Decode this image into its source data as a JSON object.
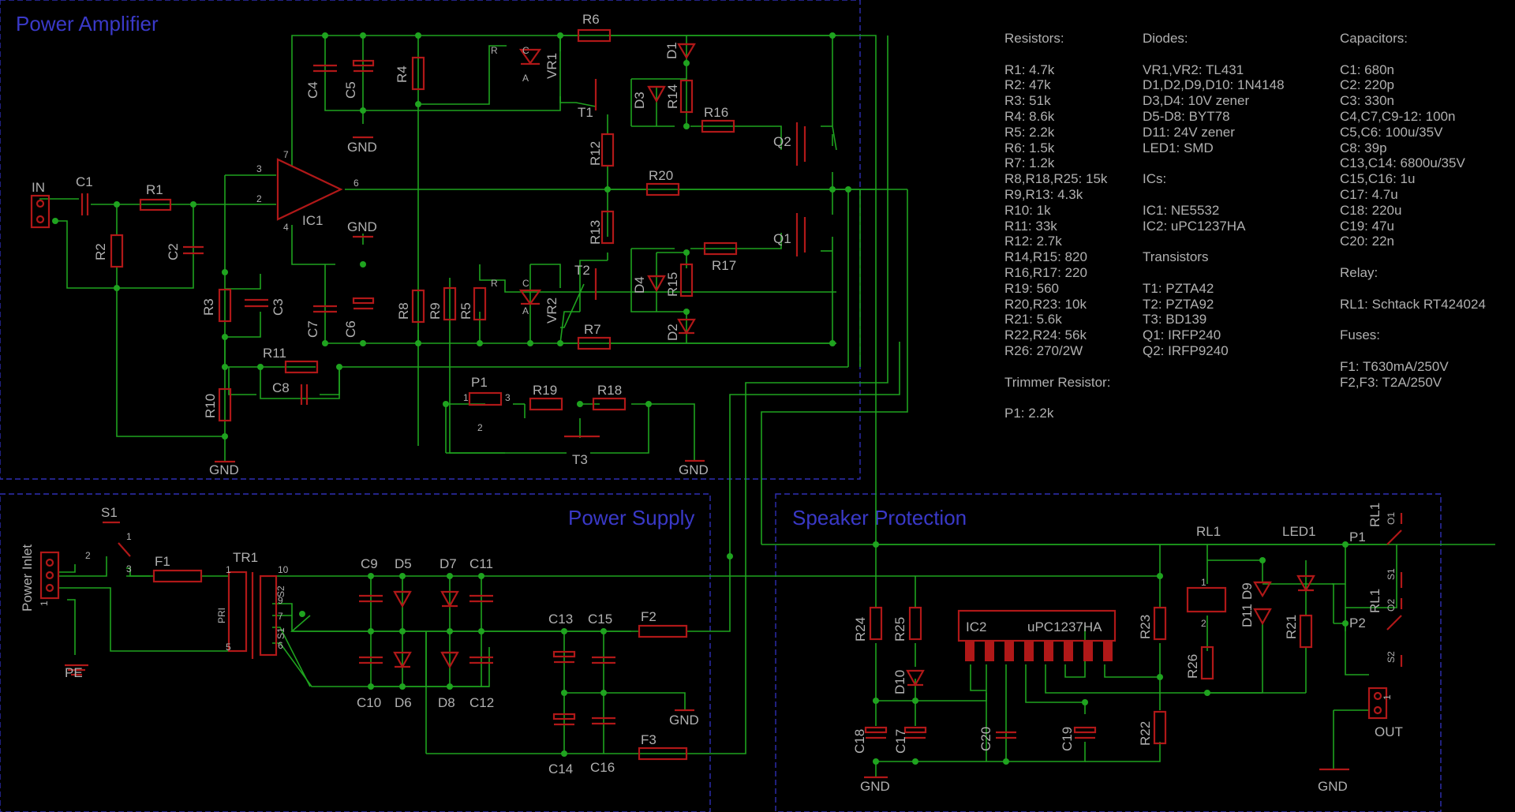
{
  "sections": {
    "amp": "Power Amplifier",
    "psu": "Power Supply",
    "prot": "Speaker Protection"
  },
  "labels": {
    "R1": "R1",
    "R2": "R2",
    "R3": "R3",
    "R4": "R4",
    "R5": "R5",
    "R6": "R6",
    "R7": "R7",
    "R8": "R8",
    "R9": "R9",
    "R10": "R10",
    "R11": "R11",
    "R12": "R12",
    "R13": "R13",
    "R14": "R14",
    "R15": "R15",
    "R16": "R16",
    "R17": "R17",
    "R18": "R18",
    "R19": "R19",
    "R20": "R20",
    "R21": "R21",
    "R22": "R22",
    "R23": "R23",
    "R24": "R24",
    "R25": "R25",
    "R26": "R26",
    "C1": "C1",
    "C2": "C2",
    "C3": "C3",
    "C4": "C4",
    "C5": "C5",
    "C6": "C6",
    "C7": "C7",
    "C8": "C8",
    "C9": "C9",
    "C10": "C10",
    "C11": "C11",
    "C12": "C12",
    "C13": "C13",
    "C14": "C14",
    "C15": "C15",
    "C16": "C16",
    "C17": "C17",
    "C18": "C18",
    "C19": "C19",
    "C20": "C20",
    "D1": "D1",
    "D2": "D2",
    "D3": "D3",
    "D4": "D4",
    "D5": "D5",
    "D6": "D6",
    "D7": "D7",
    "D8": "D8",
    "D9": "D9",
    "D10": "D10",
    "D11": "D11",
    "VR1": "VR1",
    "VR2": "VR2",
    "T1": "T1",
    "T2": "T2",
    "T3": "T3",
    "Q1": "Q1",
    "Q2": "Q2",
    "IC1": "IC1",
    "IC2": "IC2",
    "P1": "P1",
    "F1": "F1",
    "F2": "F2",
    "F3": "F3",
    "TR1": "TR1",
    "S1": "S1",
    "RL1": "RL1",
    "LED1": "LED1",
    "IN": "IN",
    "OUT": "OUT",
    "PE": "PE",
    "GND": "GND",
    "power_inlet": "Power Inlet",
    "ic2_part": "uPC1237HA",
    "O1": "O1",
    "O2": "O2",
    "S1c": "S1",
    "S2c": "S2",
    "P1c": "P1",
    "P2c": "P2",
    "PRI": "PRI",
    "S1t": "S1",
    "S2t": "S2",
    "pin1": "1",
    "pin2": "2",
    "pin3": "3",
    "pin4": "4",
    "pin5": "5",
    "pin6": "6",
    "pin7": "7",
    "pin9": "9",
    "pin10": "10",
    "pinR": "R",
    "pinA": "A",
    "pinC": "C"
  },
  "bom": {
    "resistors": {
      "title": "Resistors:",
      "items": [
        "R1: 4.7k",
        "R2: 47k",
        "R3: 51k",
        "R4: 8.6k",
        "R5: 2.2k",
        "R6: 1.5k",
        "R7: 1.2k",
        "R8,R18,R25: 15k",
        "R9,R13: 4.3k",
        "R10: 1k",
        "R11: 33k",
        "R12: 2.7k",
        "R14,R15: 820",
        "R16,R17: 220",
        "R19: 560",
        "R20,R23: 10k",
        "R21: 5.6k",
        "R22,R24: 56k",
        "R26: 270/2W"
      ]
    },
    "trimmer": {
      "title": "Trimmer Resistor:",
      "items": [
        "P1: 2.2k"
      ]
    },
    "diodes": {
      "title": "Diodes:",
      "items": [
        "VR1,VR2: TL431",
        "D1,D2,D9,D10: 1N4148",
        "D3,D4: 10V zener",
        "D5-D8: BYT78",
        "D11: 24V zener",
        "LED1: SMD"
      ]
    },
    "ics": {
      "title": "ICs:",
      "items": [
        "IC1: NE5532",
        "IC2: uPC1237HA"
      ]
    },
    "transistors": {
      "title": "Transistors",
      "items": [
        "T1: PZTA42",
        "T2: PZTA92",
        "T3: BD139",
        "Q1: IRFP240",
        "Q2: IRFP9240"
      ]
    },
    "capacitors": {
      "title": "Capacitors:",
      "items": [
        "C1: 680n",
        "C2: 220p",
        "C3: 330n",
        "C4,C7,C9-12: 100n",
        "C5,C6: 100u/35V",
        "C8: 39p",
        "C13,C14: 6800u/35V",
        "C15,C16: 1u",
        "C17: 4.7u",
        "C18: 220u",
        "C19: 47u",
        "C20: 22n"
      ]
    },
    "relay": {
      "title": "Relay:",
      "items": [
        "RL1: Schtack RT424024"
      ]
    },
    "fuses": {
      "title": "Fuses:",
      "items": [
        "F1: T630mA/250V",
        "F2,F3: T2A/250V"
      ]
    }
  },
  "colors": {
    "background": "#000000",
    "wire": "#1fa31f",
    "part": "#b01818",
    "frame": "#2f2fb4",
    "section_title": "#3a39c8",
    "label": "#b0b0b0"
  }
}
